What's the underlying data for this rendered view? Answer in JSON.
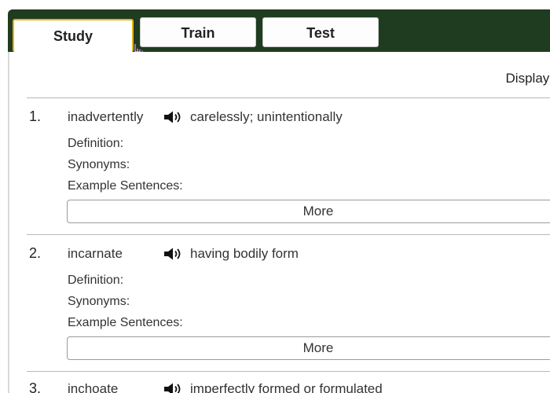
{
  "tabs": [
    {
      "label": "Study"
    },
    {
      "label": "Train"
    },
    {
      "label": "Test"
    }
  ],
  "display_label": "Display:",
  "entries": [
    {
      "number": "1.",
      "word": "inadvertently",
      "meaning": "carelessly; unintentionally",
      "definition_label": "Definition:",
      "synonyms_label": "Synonyms:",
      "examples_label": "Example Sentences:",
      "more_label": "More"
    },
    {
      "number": "2.",
      "word": "incarnate",
      "meaning": "having bodily form",
      "definition_label": "Definition:",
      "synonyms_label": "Synonyms:",
      "examples_label": "Example Sentences:",
      "more_label": "More"
    },
    {
      "number": "3.",
      "word": "inchoate",
      "meaning": "imperfectly formed or formulated"
    }
  ],
  "colors": {
    "tabbar_bg": "#1f3c21",
    "active_tab_border": "#e6b318"
  },
  "icons": {
    "speaker": "speaker-icon",
    "cursor": "hand-pointer-icon"
  }
}
